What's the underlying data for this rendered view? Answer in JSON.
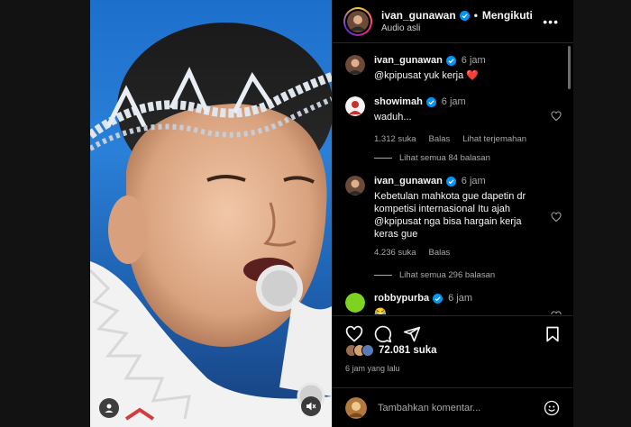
{
  "post": {
    "username": "ivan_gunawan",
    "follow_status": "Mengikuti",
    "audio": "Audio asli",
    "caption_user": "ivan_gunawan",
    "caption_time": "6 jam",
    "caption_text": "@kpipusat yuk kerja ❤️"
  },
  "comments": [
    {
      "user": "showimah",
      "time": "6 jam",
      "text": "waduh...",
      "likes": "1.312 suka",
      "reply_label": "Balas",
      "translate_label": "Lihat terjemahan",
      "view_replies": "Lihat semua 84 balasan"
    },
    {
      "user": "ivan_gunawan",
      "time": "6 jam",
      "text_lines": [
        "Kebetulan mahkota gue dapetin dr",
        "kompetisi internasional Itu ajah",
        "@kpipusat nga bisa hargain kerja",
        "keras gue"
      ],
      "likes": "4.236 suka",
      "reply_label": "Balas",
      "view_replies": "Lihat semua 296 balasan"
    },
    {
      "user": "robbypurba",
      "time": "6 jam",
      "text": "😂"
    }
  ],
  "stats": {
    "likes": "72.081 suka",
    "time_ago": "6 jam yang lalu"
  },
  "composer": {
    "placeholder": "Tambahkan komentar..."
  },
  "icons": {
    "verified": "verified-badge-icon",
    "more": "more-options-icon",
    "like": "heart-icon",
    "comment": "comment-icon",
    "share": "share-icon",
    "save": "bookmark-icon",
    "emoji": "emoji-icon",
    "mute": "mute-icon",
    "user": "user-tag-icon"
  },
  "colors": {
    "verified": "#0095f6",
    "heart": "#ed4956",
    "text_muted": "#a8a8a8",
    "background": "#000000"
  }
}
